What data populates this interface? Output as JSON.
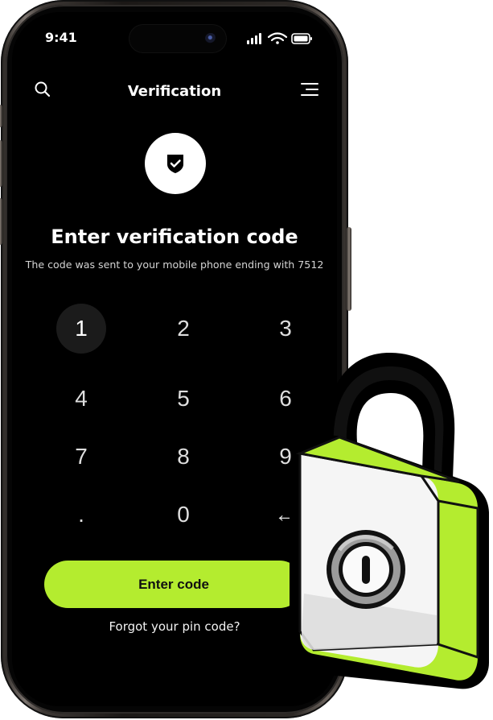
{
  "status_bar": {
    "time": "9:41",
    "icons": [
      "signal-icon",
      "wifi-icon",
      "battery-icon"
    ]
  },
  "header": {
    "title": "Verification",
    "left_icon": "search-icon",
    "right_icon": "menu-icon"
  },
  "hero": {
    "icon": "shield-check-icon",
    "headline": "Enter verification code",
    "description": "The code was sent to your mobile phone ending with 7512"
  },
  "keypad": {
    "keys": [
      "1",
      "2",
      "3",
      "4",
      "5",
      "6",
      "7",
      "8",
      "9",
      ".",
      "0",
      "←"
    ],
    "selected_key": "1"
  },
  "actions": {
    "enter_label": "Enter code",
    "forgot_label": "Forgot your pin code?"
  },
  "colors": {
    "background": "#000000",
    "accent": "#b4ec2f",
    "active_key": "#1b1b1b",
    "text": "#ffffff"
  },
  "decoration": {
    "lock_icon": "padlock-illustration"
  }
}
